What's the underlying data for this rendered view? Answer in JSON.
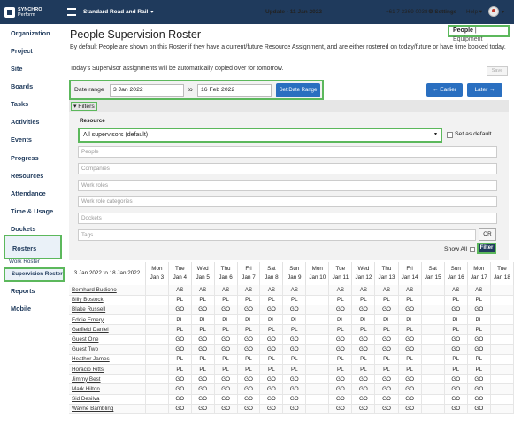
{
  "app": {
    "logo_line1": "SYNCHRO",
    "logo_line2": "Perform"
  },
  "topbar": {
    "project": "Standard Road and Rail",
    "update": "Update - 11 Jan 2022",
    "phone": "+61 7 3369 0038",
    "settings": "Settings",
    "help": "Help"
  },
  "sidebar": {
    "items": [
      {
        "label": "Organization"
      },
      {
        "label": "Project"
      },
      {
        "label": "Site"
      },
      {
        "label": "Boards"
      },
      {
        "label": "Tasks"
      },
      {
        "label": "Activities"
      },
      {
        "label": "Events"
      },
      {
        "label": "Progress"
      },
      {
        "label": "Resources"
      },
      {
        "label": "Attendance"
      },
      {
        "label": "Time & Usage"
      },
      {
        "label": "Dockets"
      },
      {
        "label": "Rosters"
      },
      {
        "label": "Reports"
      },
      {
        "label": "Mobile"
      }
    ],
    "sub_items": [
      {
        "label": "Work Roster"
      },
      {
        "label": "Supervision Roster"
      }
    ],
    "active": "Rosters",
    "active_sub": "Supervision Roster"
  },
  "page": {
    "title": "People Supervision Roster",
    "toggle_people": "People",
    "toggle_sep": " | ",
    "toggle_equipment": "Equipment",
    "intro": "By default People are shown on this Roster if they have a current/future Resource Assignment, and are either rostered on today/future or have time booked today.",
    "intro2": "Today's Supervisor assignments will be automatically copied over for tomorrow.",
    "save_label": "Save"
  },
  "daterange": {
    "label": "Date range",
    "from": "3 Jan 2022",
    "to_label": "to",
    "to": "16 Feb 2022",
    "set_label": "Set Date Range",
    "earlier_label": "← Earlier",
    "later_label": "Later →"
  },
  "filters": {
    "toggle_label": "▾ Filters",
    "resource_label": "Resource",
    "resource_value": "All supervisors (default)",
    "set_default_label": "Set as default",
    "placeholders": [
      "People",
      "Companies",
      "Work roles",
      "Work role categories",
      "Dockets",
      "Tags"
    ],
    "or_label": "OR",
    "show_all_label": "Show All",
    "filter_label": "Filter"
  },
  "roster": {
    "range_label": "3 Jan 2022 to 18 Jan 2022",
    "days": [
      {
        "dow": "Mon",
        "date": "Jan 3"
      },
      {
        "dow": "Tue",
        "date": "Jan 4"
      },
      {
        "dow": "Wed",
        "date": "Jan 5"
      },
      {
        "dow": "Thu",
        "date": "Jan 6"
      },
      {
        "dow": "Fri",
        "date": "Jan 7"
      },
      {
        "dow": "Sat",
        "date": "Jan 8"
      },
      {
        "dow": "Sun",
        "date": "Jan 9"
      },
      {
        "dow": "Mon",
        "date": "Jan 10"
      },
      {
        "dow": "Tue",
        "date": "Jan 11"
      },
      {
        "dow": "Wed",
        "date": "Jan 12"
      },
      {
        "dow": "Thu",
        "date": "Jan 13"
      },
      {
        "dow": "Fri",
        "date": "Jan 14"
      },
      {
        "dow": "Sat",
        "date": "Jan 15"
      },
      {
        "dow": "Sun",
        "date": "Jan 16"
      },
      {
        "dow": "Mon",
        "date": "Jan 17"
      },
      {
        "dow": "Tue",
        "date": "Jan 18"
      }
    ],
    "rows": [
      {
        "name": "Bernhard Budiono",
        "cells": [
          "",
          "AS",
          "AS",
          "AS",
          "AS",
          "AS",
          "AS",
          "",
          "AS",
          "AS",
          "AS",
          "AS",
          "",
          "AS",
          "AS",
          ""
        ]
      },
      {
        "name": "Billy Bostock",
        "cells": [
          "",
          "PL",
          "PL",
          "PL",
          "PL",
          "PL",
          "PL",
          "",
          "PL",
          "PL",
          "PL",
          "PL",
          "",
          "PL",
          "PL",
          ""
        ]
      },
      {
        "name": "Blake Russell",
        "cells": [
          "",
          "GO",
          "GO",
          "GO",
          "GO",
          "GO",
          "GO",
          "",
          "GO",
          "GO",
          "GO",
          "GO",
          "",
          "GO",
          "GO",
          ""
        ]
      },
      {
        "name": "Eddie Emery",
        "cells": [
          "",
          "PL",
          "PL",
          "PL",
          "PL",
          "PL",
          "PL",
          "",
          "PL",
          "PL",
          "PL",
          "PL",
          "",
          "PL",
          "PL",
          ""
        ]
      },
      {
        "name": "Garfield Daniel",
        "cells": [
          "",
          "PL",
          "PL",
          "PL",
          "PL",
          "PL",
          "PL",
          "",
          "PL",
          "PL",
          "PL",
          "PL",
          "",
          "PL",
          "PL",
          ""
        ]
      },
      {
        "name": "Guest One",
        "cells": [
          "",
          "GO",
          "GO",
          "GO",
          "GO",
          "GO",
          "GO",
          "",
          "GO",
          "GO",
          "GO",
          "GO",
          "",
          "GO",
          "GO",
          ""
        ]
      },
      {
        "name": "Guest Two",
        "cells": [
          "",
          "GO",
          "GO",
          "GO",
          "GO",
          "GO",
          "GO",
          "",
          "GO",
          "GO",
          "GO",
          "GO",
          "",
          "GO",
          "GO",
          ""
        ]
      },
      {
        "name": "Heather James",
        "cells": [
          "",
          "PL",
          "PL",
          "PL",
          "PL",
          "PL",
          "PL",
          "",
          "PL",
          "PL",
          "PL",
          "PL",
          "",
          "PL",
          "PL",
          ""
        ]
      },
      {
        "name": "Horacio Ritts",
        "cells": [
          "",
          "PL",
          "PL",
          "PL",
          "PL",
          "PL",
          "PL",
          "",
          "PL",
          "PL",
          "PL",
          "PL",
          "",
          "PL",
          "PL",
          ""
        ]
      },
      {
        "name": "Jimmy Best",
        "cells": [
          "",
          "GO",
          "GO",
          "GO",
          "GO",
          "GO",
          "GO",
          "",
          "GO",
          "GO",
          "GO",
          "GO",
          "",
          "GO",
          "GO",
          ""
        ]
      },
      {
        "name": "Mark Hilton",
        "cells": [
          "",
          "GO",
          "GO",
          "GO",
          "GO",
          "GO",
          "GO",
          "",
          "GO",
          "GO",
          "GO",
          "GO",
          "",
          "GO",
          "GO",
          ""
        ]
      },
      {
        "name": "Sid Desilva",
        "cells": [
          "",
          "GO",
          "GO",
          "GO",
          "GO",
          "GO",
          "GO",
          "",
          "GO",
          "GO",
          "GO",
          "GO",
          "",
          "GO",
          "GO",
          ""
        ]
      },
      {
        "name": "Wayne Bambling",
        "cells": [
          "",
          "GO",
          "GO",
          "GO",
          "GO",
          "GO",
          "GO",
          "",
          "GO",
          "GO",
          "GO",
          "GO",
          "",
          "GO",
          "GO",
          ""
        ]
      }
    ]
  },
  "colors": {
    "navy": "#1f3a5c",
    "blue_button": "#2a6fc0",
    "highlight_green": "#5cb85c"
  }
}
